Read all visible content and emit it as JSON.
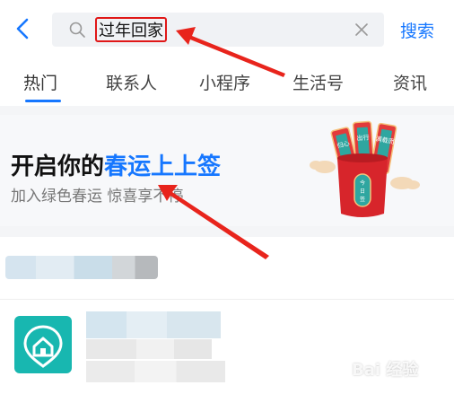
{
  "search": {
    "query": "过年回家",
    "submit_label": "搜索"
  },
  "tabs": [
    {
      "label": "热门"
    },
    {
      "label": "联系人"
    },
    {
      "label": "小程序"
    },
    {
      "label": "生活号"
    },
    {
      "label": "资讯"
    }
  ],
  "banner": {
    "title_prefix": "开启你的",
    "title_highlight": "春运上上签",
    "subtitle": "加入绿色春运 惊喜享不停",
    "card_texts": [
      "出行",
      "平安",
      "归心",
      "满载而",
      "今日签"
    ]
  },
  "watermark": "Bai 经验",
  "colors": {
    "accent": "#1677ff",
    "highlight_box": "#e01818",
    "app_icon": "#18b7b0"
  },
  "icons": {
    "back": "chevron-left-icon",
    "search": "search-icon",
    "clear": "close-icon"
  }
}
